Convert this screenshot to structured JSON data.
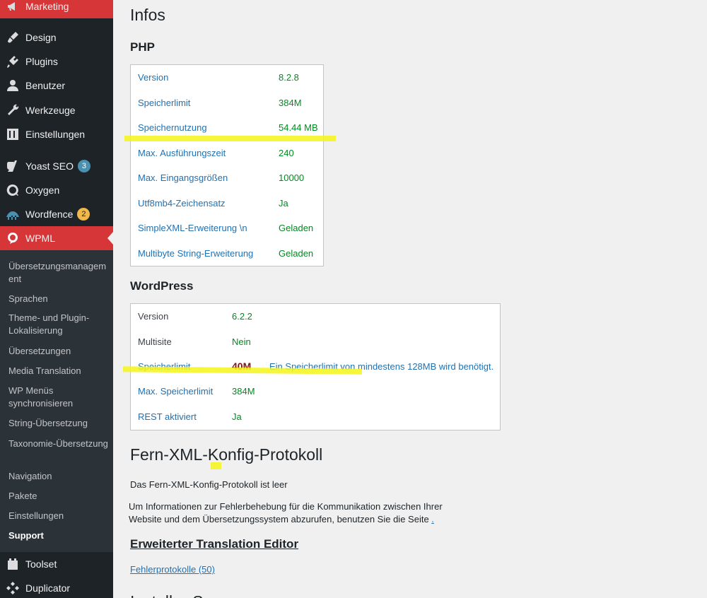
{
  "sidebar": {
    "marketing": "Marketing",
    "items": [
      {
        "label": "Design",
        "icon": "paintbrush-icon"
      },
      {
        "label": "Plugins",
        "icon": "plugin-icon"
      },
      {
        "label": "Benutzer",
        "icon": "user-icon"
      },
      {
        "label": "Werkzeuge",
        "icon": "wrench-icon"
      },
      {
        "label": "Einstellungen",
        "icon": "settings-sliders-icon"
      },
      {
        "label": "Yoast SEO",
        "icon": "yoast-icon",
        "badge": "3"
      },
      {
        "label": "Oxygen",
        "icon": "oxygen-icon"
      },
      {
        "label": "Wordfence",
        "icon": "wordfence-icon",
        "badge": "2"
      },
      {
        "label": "WPML",
        "icon": "wpml-icon"
      }
    ],
    "submenu": [
      "Übersetzungsmanagem ent",
      "Sprachen",
      "Theme- und Plugin-Lokalisierung",
      "Übersetzungen",
      "Media Translation",
      "WP Menüs synchronisieren",
      "String-Übersetzung",
      "Taxonomie-Übersetzung",
      "Navigation",
      "Pakete",
      "Einstellungen",
      "Support"
    ],
    "bottom": [
      {
        "label": "Toolset",
        "icon": "toolset-icon"
      },
      {
        "label": "Duplicator",
        "icon": "duplicator-icon"
      }
    ]
  },
  "main": {
    "title": "Infos",
    "php": {
      "heading": "PHP",
      "rows": [
        {
          "label": "Version",
          "value": "8.2.8"
        },
        {
          "label": "Speicherlimit",
          "value": "384M"
        },
        {
          "label": "Speichernutzung",
          "value": "54.44 MB"
        },
        {
          "label": "Max. Ausführungszeit",
          "value": "240"
        },
        {
          "label": "Max. Eingangsgrößen",
          "value": "10000"
        },
        {
          "label": "Utf8mb4-Zeichensatz",
          "value": "Ja"
        },
        {
          "label": "SimpleXML-Erweiterung \\n",
          "value": "Geladen"
        },
        {
          "label": "Multibyte String-Erweiterung",
          "value": "Geladen"
        }
      ]
    },
    "wordpress": {
      "heading": "WordPress",
      "rows": [
        {
          "label": "Version",
          "value": "6.2.2"
        },
        {
          "label": "Multisite",
          "value": "Nein"
        },
        {
          "label": "Speicherlimit",
          "value": "40M",
          "note": "Ein Speicherlimit von mindestens 128MB wird benötigt."
        },
        {
          "label": "Max. Speicherlimit",
          "value": "384M"
        },
        {
          "label": "REST aktiviert",
          "value": "Ja"
        }
      ]
    },
    "xml_log": {
      "heading": "Fern-XML-Konfig-Protokoll",
      "empty": "Das Fern-XML-Konfig-Protokoll ist leer",
      "info_line1": "Um Informationen zur Fehlerbehebung für die Kommunikation zwischen Ihrer",
      "info_line2": "Website und dem Übersetzungssystem abzurufen, benutzen Sie die Seite",
      "info_link": "."
    },
    "editor": {
      "heading": "Erweiterter Translation Editor",
      "link": "Fehlerprotokolle (50)"
    },
    "cutoff_heading": "Installer-S..."
  },
  "colors": {
    "sidebar_bg": "#1d2327",
    "submenu_bg": "#2c3338",
    "active": "#d63638",
    "link": "#2271b1",
    "ok": "#008a20",
    "error": "#8a0f0f",
    "highlight": "#f5f51a"
  }
}
